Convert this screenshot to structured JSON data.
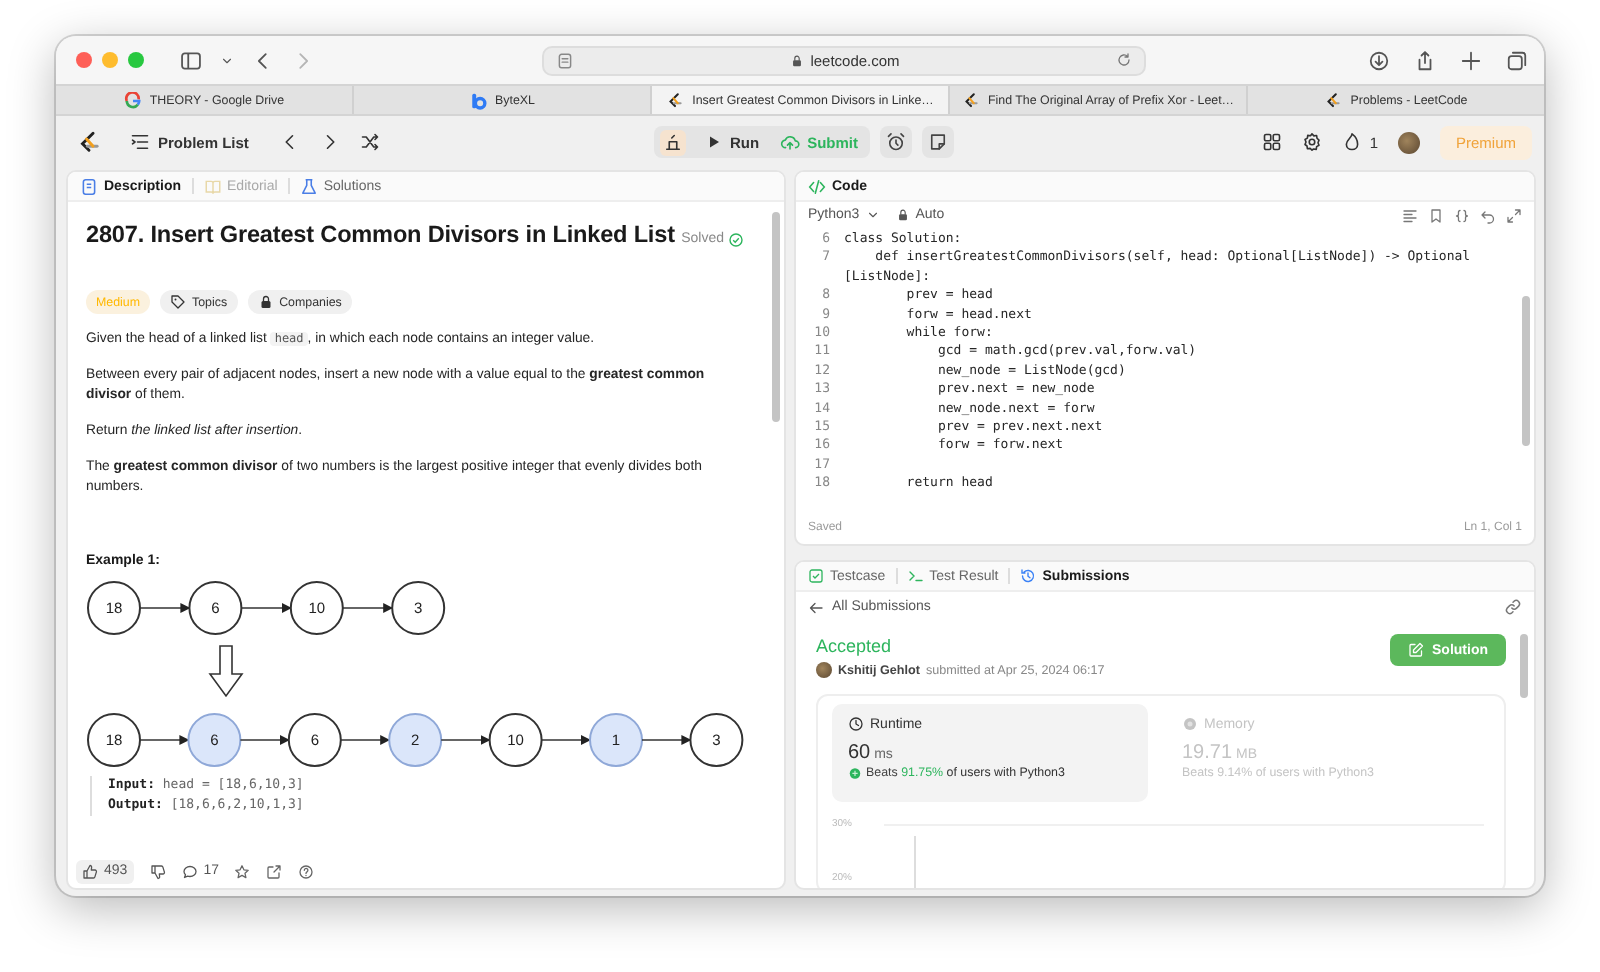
{
  "browser": {
    "url": "leetcode.com",
    "tabs": [
      {
        "title": "THEORY - Google Drive",
        "selected": false
      },
      {
        "title": "ByteXL",
        "selected": false
      },
      {
        "title": "Insert Greatest Common Divisors in Linke…",
        "selected": true
      },
      {
        "title": "Find The Original Array of Prefix Xor - Leet…",
        "selected": false
      },
      {
        "title": "Problems - LeetCode",
        "selected": false
      }
    ]
  },
  "toolbar": {
    "problem_list": "Problem List",
    "run": "Run",
    "submit": "Submit",
    "streak": "1",
    "premium": "Premium"
  },
  "description": {
    "tabs": [
      {
        "label": "Description",
        "selected": true,
        "disabled": false
      },
      {
        "label": "Editorial",
        "selected": false,
        "disabled": true
      },
      {
        "label": "Solutions",
        "selected": false,
        "disabled": false
      }
    ],
    "title": "2807. Insert Greatest Common Divisors in Linked List",
    "status": "Solved",
    "tags": [
      {
        "label": "Medium",
        "kind": "difficulty"
      },
      {
        "label": "Topics",
        "kind": "topics"
      },
      {
        "label": "Companies",
        "kind": "companies"
      }
    ],
    "paragraphs": [
      {
        "segments": [
          {
            "kind": "text",
            "text": "Given the head of a linked list "
          },
          {
            "kind": "code",
            "text": "head"
          },
          {
            "kind": "text",
            "text": ", in which each node contains an integer value."
          }
        ]
      },
      {
        "segments": [
          {
            "kind": "text",
            "text": "Between every pair of adjacent nodes, insert a new node with a value equal to the **greatest common divisor** of them."
          }
        ]
      },
      {
        "segments": [
          {
            "kind": "text",
            "text": "Return *the linked list after insertion*."
          }
        ]
      },
      {
        "segments": [
          {
            "kind": "text",
            "text": "The **greatest common divisor** of two numbers is the largest positive integer that evenly divides both numbers."
          }
        ]
      }
    ],
    "example": {
      "title": "Example 1:",
      "input_nodes": [
        {
          "value": "18",
          "inserted": false
        },
        {
          "value": "6",
          "inserted": false
        },
        {
          "value": "10",
          "inserted": false
        },
        {
          "value": "3",
          "inserted": false
        }
      ],
      "output_nodes": [
        {
          "value": "18",
          "inserted": false
        },
        {
          "value": "6",
          "inserted": true
        },
        {
          "value": "6",
          "inserted": false
        },
        {
          "value": "2",
          "inserted": true
        },
        {
          "value": "10",
          "inserted": false
        },
        {
          "value": "1",
          "inserted": true
        },
        {
          "value": "3",
          "inserted": false
        }
      ],
      "io": [
        "**Input:** head = [18,6,10,3]",
        "**Output:** [18,6,6,2,10,1,3]"
      ]
    },
    "likes": "493",
    "comments": "17"
  },
  "code": {
    "title": "Code",
    "language": "Python3",
    "mode": "Auto",
    "lines": [
      {
        "number": "6",
        "text": "class Solution:"
      },
      {
        "number": "7",
        "text": "    def insertGreatestCommonDivisors(self, head: Optional[ListNode]) -> Optional",
        "wrap": "[ListNode]:"
      },
      {
        "number": "8",
        "text": "        prev = head"
      },
      {
        "number": "9",
        "text": "        forw = head.next"
      },
      {
        "number": "10",
        "text": "        while forw:"
      },
      {
        "number": "11",
        "text": "            gcd = math.gcd(prev.val,forw.val)"
      },
      {
        "number": "12",
        "text": "            new_node = ListNode(gcd)"
      },
      {
        "number": "13",
        "text": "            prev.next = new_node"
      },
      {
        "number": "14",
        "text": "            new_node.next = forw"
      },
      {
        "number": "15",
        "text": "            prev = prev.next.next"
      },
      {
        "number": "16",
        "text": "            forw = forw.next"
      },
      {
        "number": "17"
      },
      {
        "number": "18",
        "text": "        return head"
      }
    ],
    "status": "Saved",
    "cursor": "Ln 1, Col 1"
  },
  "results": {
    "tabs": [
      {
        "label": "Testcase",
        "selected": false
      },
      {
        "label": "Test Result",
        "selected": false
      },
      {
        "label": "Submissions",
        "selected": true
      }
    ],
    "back": "All Submissions",
    "verdict": "Accepted",
    "author": "Kshitij Gehlot",
    "submitted": "submitted at Apr 25, 2024 06:17",
    "solution_button": "Solution",
    "stats": [
      {
        "label": "Runtime",
        "value": "60",
        "unit": "ms",
        "beats": "Beats",
        "percent": "91.75%",
        "suffix": "of users with Python3",
        "selected": true
      },
      {
        "label": "Memory",
        "value": "19.71",
        "unit": "MB",
        "beats": "Beats",
        "percent": "9.14%",
        "suffix": "of users with Python3",
        "selected": false
      }
    ],
    "chart_ticks": [
      "30%",
      "20%"
    ]
  }
}
